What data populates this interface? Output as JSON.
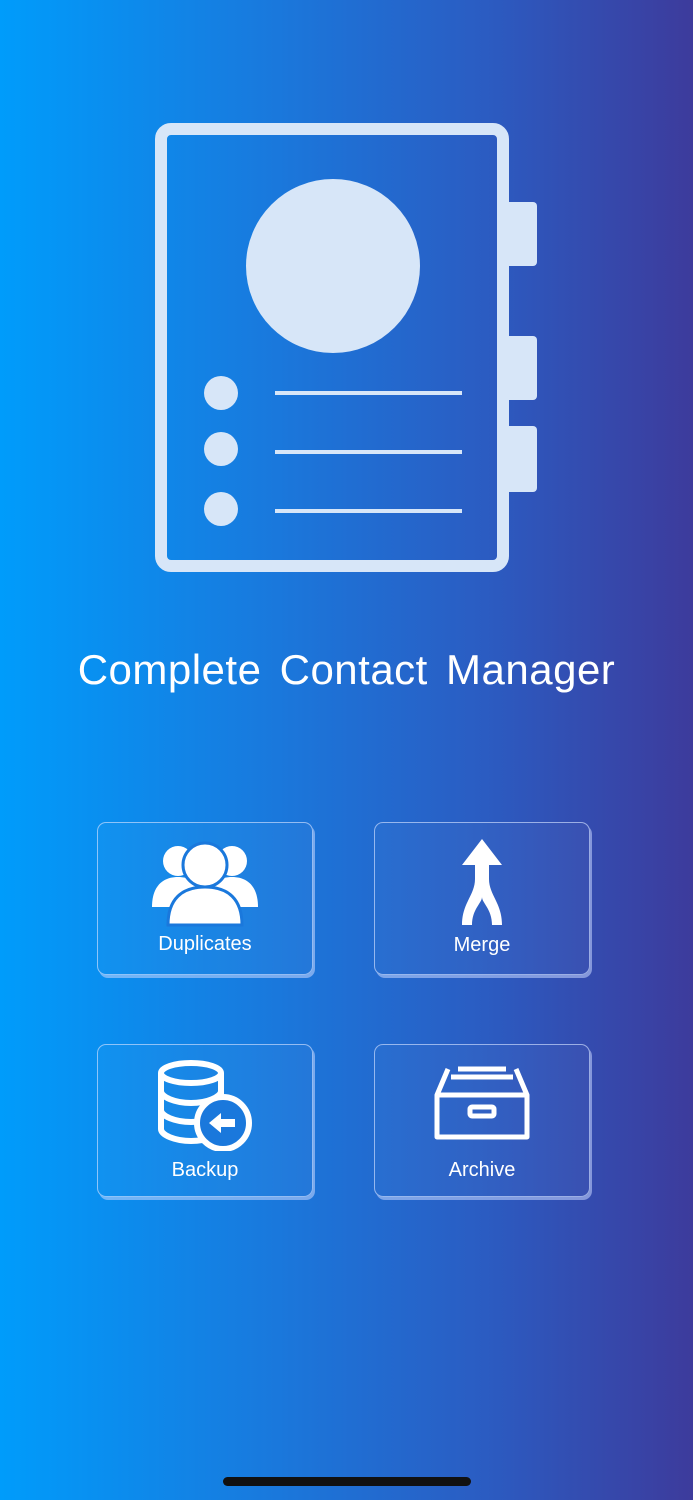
{
  "app": {
    "title": "Complete Contact Manager"
  },
  "logo": {
    "icon": "contact-book-icon",
    "color": "#d7e6f8"
  },
  "tiles": [
    {
      "label": "Duplicates",
      "icon": "users-group-icon"
    },
    {
      "label": "Merge",
      "icon": "merge-arrow-icon"
    },
    {
      "label": "Backup",
      "icon": "database-restore-icon"
    },
    {
      "label": "Archive",
      "icon": "archive-drawer-icon"
    }
  ],
  "colors": {
    "gradient_start": "#009cfb",
    "gradient_end": "#3d3b9c",
    "tile_border": "#d2e1ff",
    "text": "#ffffff"
  }
}
